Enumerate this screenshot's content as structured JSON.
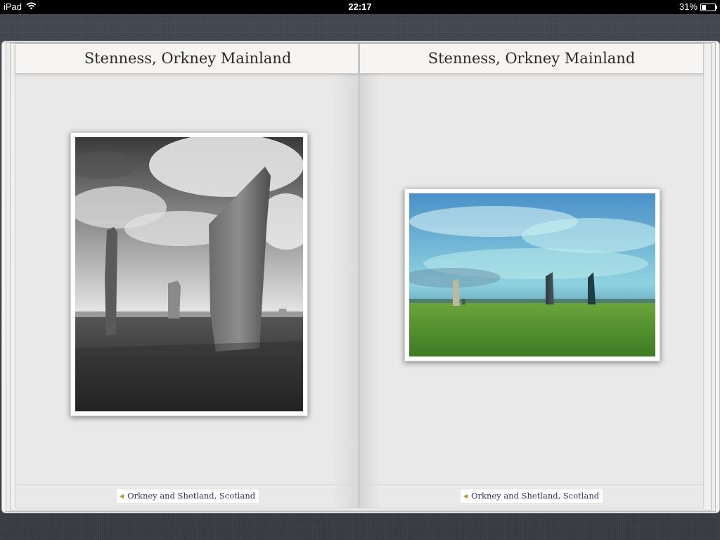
{
  "status_bar": {
    "device": "iPad",
    "time": "22:17",
    "battery": "31%",
    "battery_level": 0.31
  },
  "left_page": {
    "title": "Stenness, Orkney Mainland",
    "footer_link": "Orkney and Shetland, Scotland"
  },
  "right_page": {
    "title": "Stenness, Orkney Mainland",
    "footer_link": "Orkney and Shetland, Scotland"
  },
  "icons": {
    "wifi": "wifi-icon",
    "battery": "battery-icon",
    "back": "back-arrow-icon"
  },
  "colors": {
    "footer_link_text": "#3a2a66",
    "footer_arrow": "#b8921e",
    "page_background": "#e9e9e9"
  }
}
